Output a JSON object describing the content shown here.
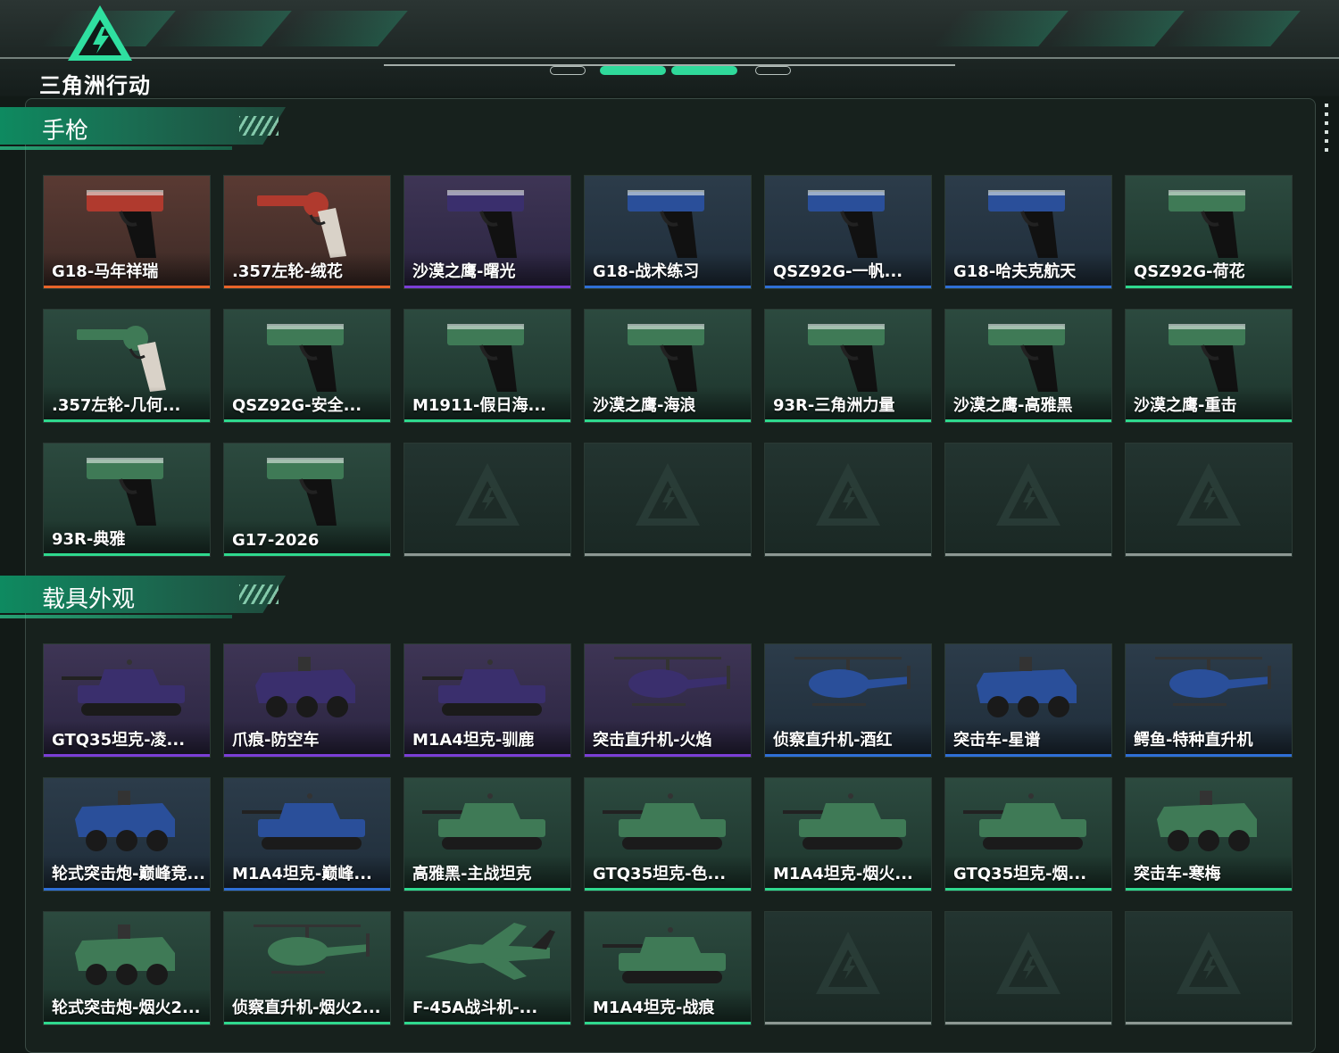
{
  "app": {
    "logo_text": "三角洲行动"
  },
  "colors": {
    "orange": "#e8642a",
    "purple": "#7b3ed6",
    "blue": "#2f6fd6",
    "green": "#2fd98e",
    "empty": "#8d9893",
    "accent": "#2fd99a"
  },
  "sections": [
    {
      "title": "手枪",
      "items": [
        {
          "label": "G18-马年祥瑞",
          "rarity": "orange",
          "icon": "pistol-icon"
        },
        {
          "label": ".357左轮-绒花",
          "rarity": "orange",
          "icon": "revolver-icon"
        },
        {
          "label": "沙漠之鹰-曙光",
          "rarity": "purple",
          "icon": "pistol-icon"
        },
        {
          "label": "G18-战术练习",
          "rarity": "blue",
          "icon": "pistol-icon"
        },
        {
          "label": "QSZ92G-一帆...",
          "rarity": "blue",
          "icon": "pistol-icon"
        },
        {
          "label": "G18-哈夫克航天",
          "rarity": "blue",
          "icon": "pistol-icon"
        },
        {
          "label": "QSZ92G-荷花",
          "rarity": "green",
          "icon": "pistol-icon"
        },
        {
          "label": ".357左轮-几何...",
          "rarity": "green",
          "icon": "revolver-icon"
        },
        {
          "label": "QSZ92G-安全...",
          "rarity": "green",
          "icon": "pistol-icon"
        },
        {
          "label": "M1911-假日海...",
          "rarity": "green",
          "icon": "pistol-icon"
        },
        {
          "label": "沙漠之鹰-海浪",
          "rarity": "green",
          "icon": "pistol-icon"
        },
        {
          "label": "93R-三角洲力量",
          "rarity": "green",
          "icon": "pistol-icon"
        },
        {
          "label": "沙漠之鹰-高雅黑",
          "rarity": "green",
          "icon": "pistol-icon"
        },
        {
          "label": "沙漠之鹰-重击",
          "rarity": "green",
          "icon": "pistol-icon"
        },
        {
          "label": "93R-典雅",
          "rarity": "green",
          "icon": "pistol-icon"
        },
        {
          "label": "G17-2026",
          "rarity": "green",
          "icon": "pistol-icon"
        },
        {
          "label": "",
          "rarity": "empty",
          "icon": "empty-slot-icon"
        },
        {
          "label": "",
          "rarity": "empty",
          "icon": "empty-slot-icon"
        },
        {
          "label": "",
          "rarity": "empty",
          "icon": "empty-slot-icon"
        },
        {
          "label": "",
          "rarity": "empty",
          "icon": "empty-slot-icon"
        },
        {
          "label": "",
          "rarity": "empty",
          "icon": "empty-slot-icon"
        }
      ]
    },
    {
      "title": "载具外观",
      "items": [
        {
          "label": "GTQ35坦克-凌...",
          "rarity": "purple",
          "icon": "tank-icon"
        },
        {
          "label": "爪痕-防空车",
          "rarity": "purple",
          "icon": "armored-vehicle-icon"
        },
        {
          "label": "M1A4坦克-驯鹿",
          "rarity": "purple",
          "icon": "tank-icon"
        },
        {
          "label": "突击直升机-火焰",
          "rarity": "purple",
          "icon": "helicopter-icon"
        },
        {
          "label": "侦察直升机-酒红",
          "rarity": "blue",
          "icon": "helicopter-icon"
        },
        {
          "label": "突击车-星谱",
          "rarity": "blue",
          "icon": "armored-vehicle-icon"
        },
        {
          "label": "鳄鱼-特种直升机",
          "rarity": "blue",
          "icon": "helicopter-icon"
        },
        {
          "label": "轮式突击炮-巅峰竞...",
          "rarity": "blue",
          "icon": "armored-vehicle-icon"
        },
        {
          "label": "M1A4坦克-巅峰...",
          "rarity": "blue",
          "icon": "tank-icon"
        },
        {
          "label": "高雅黑-主战坦克",
          "rarity": "green",
          "icon": "tank-icon"
        },
        {
          "label": "GTQ35坦克-色...",
          "rarity": "green",
          "icon": "tank-icon"
        },
        {
          "label": "M1A4坦克-烟火...",
          "rarity": "green",
          "icon": "tank-icon"
        },
        {
          "label": "GTQ35坦克-烟...",
          "rarity": "green",
          "icon": "tank-icon"
        },
        {
          "label": "突击车-寒梅",
          "rarity": "green",
          "icon": "armored-vehicle-icon"
        },
        {
          "label": "轮式突击炮-烟火2...",
          "rarity": "green",
          "icon": "armored-vehicle-icon"
        },
        {
          "label": "侦察直升机-烟火2...",
          "rarity": "green",
          "icon": "helicopter-icon"
        },
        {
          "label": "F-45A战斗机-...",
          "rarity": "green",
          "icon": "jet-icon"
        },
        {
          "label": "M1A4坦克-战痕",
          "rarity": "green",
          "icon": "tank-icon"
        },
        {
          "label": "",
          "rarity": "empty",
          "icon": "empty-slot-icon"
        },
        {
          "label": "",
          "rarity": "empty",
          "icon": "empty-slot-icon"
        },
        {
          "label": "",
          "rarity": "empty",
          "icon": "empty-slot-icon"
        }
      ]
    }
  ]
}
